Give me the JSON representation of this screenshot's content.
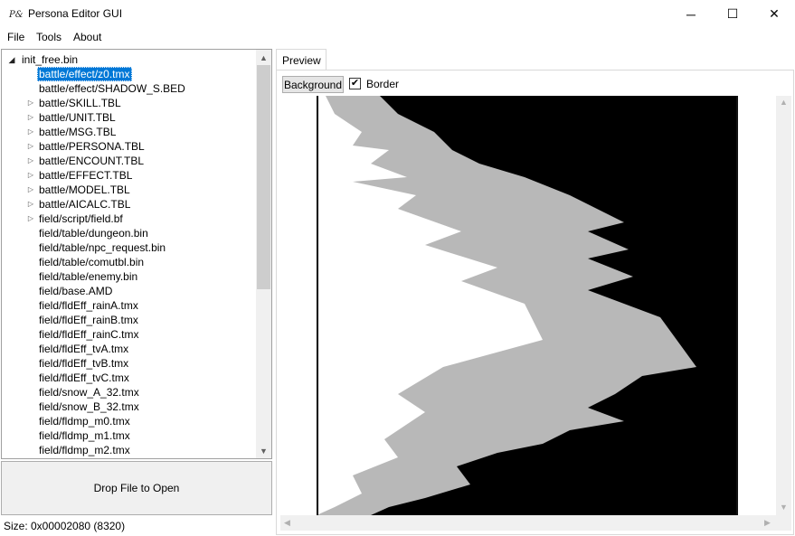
{
  "window": {
    "title": "Persona Editor GUI",
    "minimize_glyph": "─",
    "maximize_glyph": "☐",
    "close_glyph": "✕"
  },
  "menu": [
    "File",
    "Tools",
    "About"
  ],
  "tree": {
    "root": "init_free.bin",
    "items": [
      {
        "label": "battle/effect/z0.tmx",
        "expandable": false,
        "selected": true
      },
      {
        "label": "battle/effect/SHADOW_S.BED",
        "expandable": false
      },
      {
        "label": "battle/SKILL.TBL",
        "expandable": true
      },
      {
        "label": "battle/UNIT.TBL",
        "expandable": true
      },
      {
        "label": "battle/MSG.TBL",
        "expandable": true
      },
      {
        "label": "battle/PERSONA.TBL",
        "expandable": true
      },
      {
        "label": "battle/ENCOUNT.TBL",
        "expandable": true
      },
      {
        "label": "battle/EFFECT.TBL",
        "expandable": true
      },
      {
        "label": "battle/MODEL.TBL",
        "expandable": true
      },
      {
        "label": "battle/AICALC.TBL",
        "expandable": true
      },
      {
        "label": "field/script/field.bf",
        "expandable": true
      },
      {
        "label": "field/table/dungeon.bin",
        "expandable": false
      },
      {
        "label": "field/table/npc_request.bin",
        "expandable": false
      },
      {
        "label": "field/table/comutbl.bin",
        "expandable": false
      },
      {
        "label": "field/table/enemy.bin",
        "expandable": false
      },
      {
        "label": "field/base.AMD",
        "expandable": false
      },
      {
        "label": "field/fldEff_rainA.tmx",
        "expandable": false
      },
      {
        "label": "field/fldEff_rainB.tmx",
        "expandable": false
      },
      {
        "label": "field/fldEff_rainC.tmx",
        "expandable": false
      },
      {
        "label": "field/fldEff_tvA.tmx",
        "expandable": false
      },
      {
        "label": "field/fldEff_tvB.tmx",
        "expandable": false
      },
      {
        "label": "field/fldEff_tvC.tmx",
        "expandable": false
      },
      {
        "label": "field/snow_A_32.tmx",
        "expandable": false
      },
      {
        "label": "field/snow_B_32.tmx",
        "expandable": false
      },
      {
        "label": "field/fldmp_m0.tmx",
        "expandable": false
      },
      {
        "label": "field/fldmp_m1.tmx",
        "expandable": false
      },
      {
        "label": "field/fldmp_m2.tmx",
        "expandable": false
      }
    ]
  },
  "drop_area": {
    "label": "Drop File to Open"
  },
  "status": {
    "text": "Size: 0x00002080 (8320)"
  },
  "preview": {
    "tab_label": "Preview",
    "background_button": "Background",
    "border_checkbox": {
      "label": "Border",
      "checked": true,
      "mark": "✔"
    }
  },
  "colors": {
    "selection": "#0078d7",
    "panel_border": "#a0a0a0"
  }
}
